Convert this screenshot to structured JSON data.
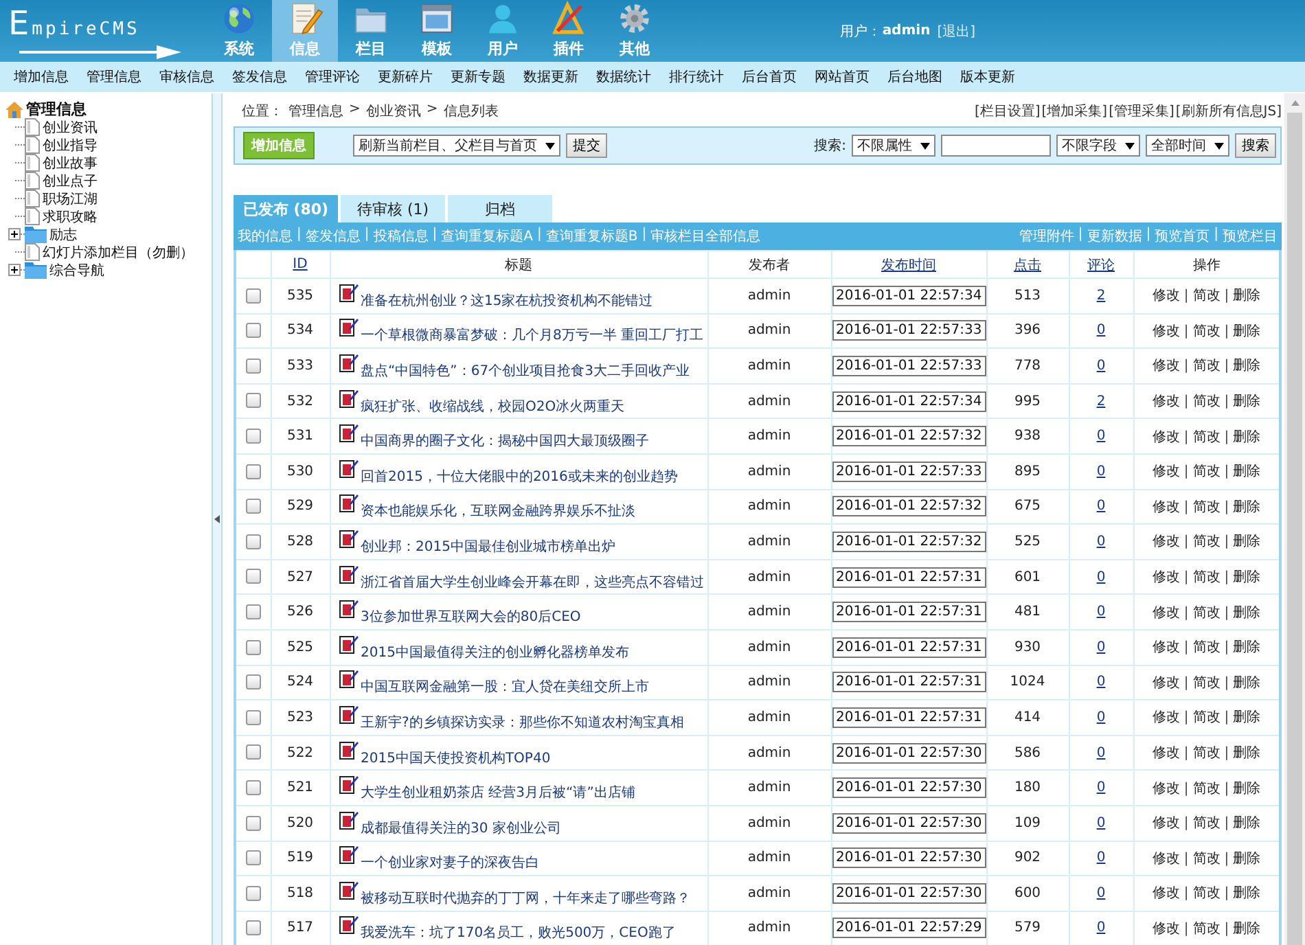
{
  "logo": "EmpireCMS",
  "main_nav": [
    {
      "label": "系统",
      "selected": false
    },
    {
      "label": "信息",
      "selected": true
    },
    {
      "label": "栏目",
      "selected": false
    },
    {
      "label": "模板",
      "selected": false
    },
    {
      "label": "用户",
      "selected": false
    },
    {
      "label": "插件",
      "selected": false
    },
    {
      "label": "其他",
      "selected": false
    }
  ],
  "user": {
    "label": "用户：",
    "name": "admin",
    "logout": "[退出]"
  },
  "sub_nav": [
    "增加信息",
    "管理信息",
    "审核信息",
    "签发信息",
    "管理评论",
    "更新碎片",
    "更新专题",
    "数据更新",
    "数据统计",
    "排行统计",
    "后台首页",
    "网站首页",
    "后台地图",
    "版本更新"
  ],
  "sidebar": {
    "tree": [
      {
        "label": "管理信息",
        "kind": "root",
        "expanded": true,
        "children": [
          {
            "label": "创业资讯",
            "kind": "page"
          },
          {
            "label": "创业指导",
            "kind": "page"
          },
          {
            "label": "创业故事",
            "kind": "page"
          },
          {
            "label": "创业点子",
            "kind": "page"
          },
          {
            "label": "职场江湖",
            "kind": "page"
          },
          {
            "label": "求职攻略",
            "kind": "page"
          },
          {
            "label": "励志",
            "kind": "folder",
            "expanded": false
          },
          {
            "label": "幻灯片添加栏目（勿删）",
            "kind": "page"
          },
          {
            "label": "综合导航",
            "kind": "folder",
            "expanded": false
          }
        ]
      }
    ]
  },
  "breadcrumb": {
    "label": "位置：",
    "separator": ">",
    "items": [
      "管理信息",
      "创业资讯",
      "信息列表"
    ]
  },
  "top_links": [
    "[栏目设置]",
    "[增加采集]",
    "[管理采集]",
    "[刷新所有信息JS]"
  ],
  "toolbar": {
    "add_button": "增加信息",
    "refresh_select": "刷新当前栏目、父栏目与首页",
    "submit": "提交",
    "search_label": "搜索:",
    "search_selects": [
      "不限属性",
      "不限字段",
      "全部时间"
    ],
    "search_button": "搜索"
  },
  "tabs": [
    {
      "label": "已发布 (80)",
      "selected": true
    },
    {
      "label": "待审核 (1)",
      "selected": false
    },
    {
      "label": "归档",
      "selected": false
    }
  ],
  "link_bar": {
    "separator": "|",
    "left": [
      "我的信息",
      "签发信息",
      "投稿信息",
      "查询重复标题A",
      "查询重复标题B",
      "审核栏目全部信息"
    ],
    "right": [
      "管理附件",
      "更新数据",
      "预览首页",
      "预览栏目"
    ]
  },
  "table": {
    "columns": [
      {
        "label": "ID",
        "sortable": true
      },
      {
        "label": "标题",
        "sortable": false
      },
      {
        "label": "发布者",
        "sortable": false
      },
      {
        "label": "发布时间",
        "sortable": true
      },
      {
        "label": "点击",
        "sortable": true
      },
      {
        "label": "评论",
        "sortable": true
      },
      {
        "label": "操作",
        "sortable": false
      }
    ],
    "action_separator": "|",
    "rows": [
      {
        "checked": false,
        "id": "535",
        "title": "准备在杭州创业？这15家在杭投资机构不能错过",
        "author": "admin",
        "time": "2016-01-01 22:57:34",
        "clicks": "513",
        "comments": "2",
        "actions": [
          "修改",
          "简改",
          "删除"
        ]
      },
      {
        "checked": false,
        "id": "534",
        "title": "一个草根微商暴富梦破：几个月8万亏一半 重回工厂打工",
        "author": "admin",
        "time": "2016-01-01 22:57:33",
        "clicks": "396",
        "comments": "0",
        "actions": [
          "修改",
          "简改",
          "删除"
        ]
      },
      {
        "checked": false,
        "id": "533",
        "title": "盘点“中国特色”：67个创业项目抢食3大二手回收产业",
        "author": "admin",
        "time": "2016-01-01 22:57:33",
        "clicks": "778",
        "comments": "0",
        "actions": [
          "修改",
          "简改",
          "删除"
        ]
      },
      {
        "checked": false,
        "id": "532",
        "title": "疯狂扩张、收缩战线，校园O2O冰火两重天",
        "author": "admin",
        "time": "2016-01-01 22:57:34",
        "clicks": "995",
        "comments": "2",
        "actions": [
          "修改",
          "简改",
          "删除"
        ]
      },
      {
        "checked": false,
        "id": "531",
        "title": "中国商界的圈子文化：揭秘中国四大最顶级圈子",
        "author": "admin",
        "time": "2016-01-01 22:57:32",
        "clicks": "938",
        "comments": "0",
        "actions": [
          "修改",
          "简改",
          "删除"
        ]
      },
      {
        "checked": false,
        "id": "530",
        "title": "回首2015，十位大佬眼中的2016或未来的创业趋势",
        "author": "admin",
        "time": "2016-01-01 22:57:33",
        "clicks": "895",
        "comments": "0",
        "actions": [
          "修改",
          "简改",
          "删除"
        ]
      },
      {
        "checked": false,
        "id": "529",
        "title": "资本也能娱乐化，互联网金融跨界娱乐不扯淡",
        "author": "admin",
        "time": "2016-01-01 22:57:32",
        "clicks": "675",
        "comments": "0",
        "actions": [
          "修改",
          "简改",
          "删除"
        ]
      },
      {
        "checked": false,
        "id": "528",
        "title": "创业邦：2015中国最佳创业城市榜单出炉",
        "author": "admin",
        "time": "2016-01-01 22:57:32",
        "clicks": "525",
        "comments": "0",
        "actions": [
          "修改",
          "简改",
          "删除"
        ]
      },
      {
        "checked": false,
        "id": "527",
        "title": "浙江省首届大学生创业峰会开幕在即，这些亮点不容错过",
        "author": "admin",
        "time": "2016-01-01 22:57:31",
        "clicks": "601",
        "comments": "0",
        "actions": [
          "修改",
          "简改",
          "删除"
        ]
      },
      {
        "checked": false,
        "id": "526",
        "title": "3位参加世界互联网大会的80后CEO",
        "author": "admin",
        "time": "2016-01-01 22:57:31",
        "clicks": "481",
        "comments": "0",
        "actions": [
          "修改",
          "简改",
          "删除"
        ]
      },
      {
        "checked": false,
        "id": "525",
        "title": "2015中国最值得关注的创业孵化器榜单发布",
        "author": "admin",
        "time": "2016-01-01 22:57:31",
        "clicks": "930",
        "comments": "0",
        "actions": [
          "修改",
          "简改",
          "删除"
        ]
      },
      {
        "checked": false,
        "id": "524",
        "title": "中国互联网金融第一股：宜人贷在美纽交所上市",
        "author": "admin",
        "time": "2016-01-01 22:57:31",
        "clicks": "1024",
        "comments": "0",
        "actions": [
          "修改",
          "简改",
          "删除"
        ]
      },
      {
        "checked": false,
        "id": "523",
        "title": "王新宇?的乡镇探访实录：那些你不知道农村淘宝真相",
        "author": "admin",
        "time": "2016-01-01 22:57:31",
        "clicks": "414",
        "comments": "0",
        "actions": [
          "修改",
          "简改",
          "删除"
        ]
      },
      {
        "checked": false,
        "id": "522",
        "title": "2015中国天使投资机构TOP40",
        "author": "admin",
        "time": "2016-01-01 22:57:30",
        "clicks": "586",
        "comments": "0",
        "actions": [
          "修改",
          "简改",
          "删除"
        ]
      },
      {
        "checked": false,
        "id": "521",
        "title": "大学生创业租奶茶店 经营3月后被“请”出店铺",
        "author": "admin",
        "time": "2016-01-01 22:57:30",
        "clicks": "180",
        "comments": "0",
        "actions": [
          "修改",
          "简改",
          "删除"
        ]
      },
      {
        "checked": false,
        "id": "520",
        "title": "成都最值得关注的30 家创业公司",
        "author": "admin",
        "time": "2016-01-01 22:57:30",
        "clicks": "109",
        "comments": "0",
        "actions": [
          "修改",
          "简改",
          "删除"
        ]
      },
      {
        "checked": false,
        "id": "519",
        "title": "一个创业家对妻子的深夜告白",
        "author": "admin",
        "time": "2016-01-01 22:57:30",
        "clicks": "902",
        "comments": "0",
        "actions": [
          "修改",
          "简改",
          "删除"
        ]
      },
      {
        "checked": false,
        "id": "518",
        "title": "被移动互联时代抛弃的丁丁网，十年来走了哪些弯路？",
        "author": "admin",
        "time": "2016-01-01 22:57:30",
        "clicks": "600",
        "comments": "0",
        "actions": [
          "修改",
          "简改",
          "删除"
        ]
      },
      {
        "checked": false,
        "id": "517",
        "title": "我爱洗车：坑了170名员工，败光500万，CEO跑了",
        "author": "admin",
        "time": "2016-01-01 22:57:29",
        "clicks": "579",
        "comments": "0",
        "actions": [
          "修改",
          "简改",
          "删除"
        ]
      }
    ]
  }
}
